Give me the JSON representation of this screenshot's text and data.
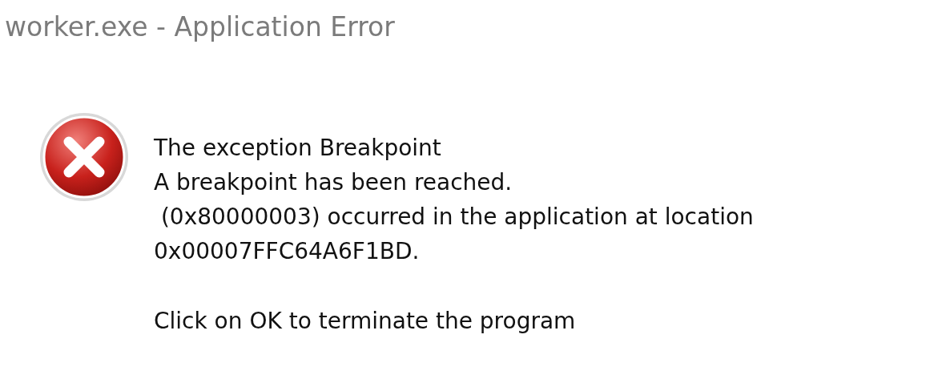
{
  "window": {
    "title": "worker.exe - Application Error"
  },
  "message": {
    "kind": "error",
    "lines": [
      "The exception Breakpoint",
      "A breakpoint has been reached.",
      " (0x80000003) occurred in the application at location",
      "0x00007FFC64A6F1BD."
    ],
    "footer": "Click on OK to terminate the program"
  }
}
